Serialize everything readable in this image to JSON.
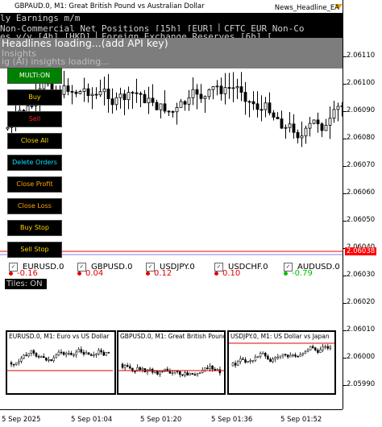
{
  "chart": {
    "title_symbol": "GBPAUD.0, M1:",
    "title_desc": "Great British Pound vs Australian Dollar",
    "ea_name": "News_Headline_EA"
  },
  "ticker": {
    "line1": "ly Earnings m/m",
    "line2": "Non-Commercial Net Positions          [15h] [EUR] ▏CFTC EUR Non-Co",
    "line3": "es y/y          [4h] [HKD] ▏Foreign Exchange Reserves         [6h] ["
  },
  "headlines": {
    "line1": "Headlines loading...(add API key)",
    "line2": "Insights",
    "line3": "ig (AI) insights loading..."
  },
  "panel": {
    "buttons": [
      {
        "label": "MULTI:ON",
        "color": "#ffffff",
        "bg": "#008000"
      },
      {
        "label": "Buy",
        "color": "#ffd700",
        "bg": "#000000"
      },
      {
        "label": "Sell",
        "color": "#ff2020",
        "bg": "#000000"
      },
      {
        "label": "Close All",
        "color": "#ffd700",
        "bg": "#000000"
      },
      {
        "label": "Delete Orders",
        "color": "#00e5ff",
        "bg": "#000000"
      },
      {
        "label": "Close Profit",
        "color": "#ffa500",
        "bg": "#000000"
      },
      {
        "label": "Close Loss",
        "color": "#ffa500",
        "bg": "#000000"
      },
      {
        "label": "Buy Stop",
        "color": "#ffd700",
        "bg": "#000000"
      },
      {
        "label": "Sell Stop",
        "color": "#ffd700",
        "bg": "#000000"
      }
    ],
    "tiles_label": "Tiles: ON"
  },
  "pairs": [
    {
      "name": "EURUSD.0",
      "value": "-0.16",
      "color": "#e00000"
    },
    {
      "name": "GBPUSD.0",
      "value": "0.04",
      "color": "#e00000"
    },
    {
      "name": "USDJPY.0",
      "value": "0.12",
      "color": "#e00000"
    },
    {
      "name": "USDCHF.0",
      "value": "0.10",
      "color": "#e00000"
    },
    {
      "name": "AUDUSD.0",
      "value": "-0.79",
      "color": "#00c000"
    }
  ],
  "price_axis": {
    "labels": [
      "2.06110",
      "2.06100",
      "2.06090",
      "2.06080",
      "2.06070",
      "2.06060",
      "2.06050",
      "2.06040",
      "2.06030",
      "2.06020",
      "2.06010",
      "2.06000",
      "2.05990"
    ],
    "current_price": "2.06038",
    "current_color": "#ff0000"
  },
  "time_axis": {
    "labels": [
      "5 Sep 2025",
      "5 Sep 01:04",
      "5 Sep 01:20",
      "5 Sep 01:36",
      "5 Sep 01:52"
    ]
  },
  "mini_charts": [
    {
      "title": "EURUSD.0, M1:  Euro vs US Dollar"
    },
    {
      "title": "GBPUSD.0, M1:  Great British Pound"
    },
    {
      "title": "USDJPY.0, M1:  US Dollar vs Japan"
    }
  ],
  "colors": {
    "bull_candle": "#ffffff",
    "bear_candle": "#000000",
    "bid_line": "#ff0000",
    "ask_line": "#8080ff"
  }
}
